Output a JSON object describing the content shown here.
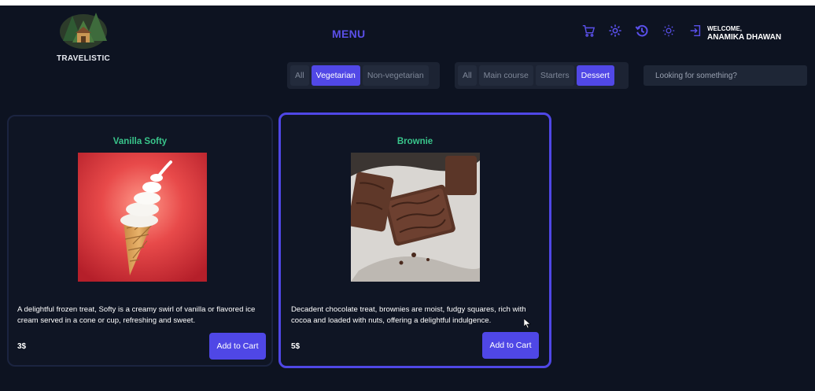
{
  "brand": {
    "name": "TRAVELISTIC"
  },
  "page": {
    "title": "MENU"
  },
  "header": {
    "welcome_label": "WELCOME,",
    "user_name": "ANAMIKA DHAWAN",
    "icons": [
      "cart-icon",
      "gear-icon",
      "history-icon",
      "sun-icon",
      "logout-icon"
    ]
  },
  "diet_filter": {
    "options": [
      "All",
      "Vegetarian",
      "Non-vegetarian"
    ],
    "selected": "Vegetarian"
  },
  "course_filter": {
    "options": [
      "All",
      "Main course",
      "Starters",
      "Dessert"
    ],
    "selected": "Dessert"
  },
  "search": {
    "placeholder": "Looking for something?"
  },
  "items": [
    {
      "name": "Vanilla Softy",
      "description": "A delightful frozen treat, Softy is a creamy swirl of vanilla or flavored ice cream served in a cone or cup, refreshing and sweet.",
      "price": "3$",
      "button": "Add to Cart",
      "selected": false
    },
    {
      "name": "Brownie",
      "description": "Decadent chocolate treat, brownies are moist, fudgy squares, rich with cocoa and loaded with nuts, offering a delightful indulgence.",
      "price": "5$",
      "button": "Add to Cart",
      "selected": true
    }
  ],
  "colors": {
    "background": "#0d1321",
    "accent": "#4f47e6",
    "item_title": "#39c58b"
  }
}
